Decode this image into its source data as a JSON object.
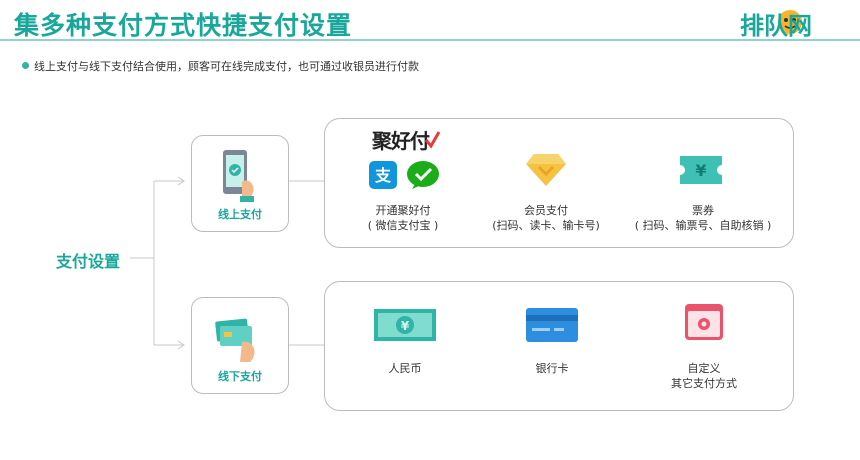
{
  "header": {
    "title": "集多种支付方式快捷支付设置",
    "brand": "排队网"
  },
  "bullet": "线上支付与线下支付结合使用，顾客可在线完成支付，也可通过收银员进行付款",
  "center_label": "支付设置",
  "online": {
    "label": "线上支付",
    "brand_text": "聚好付",
    "options": [
      {
        "line1": "开通聚好付",
        "line2": "( 微信支付宝 )"
      },
      {
        "line1": "会员支付",
        "line2": "(扫码、读卡、输卡号)"
      },
      {
        "line1": "票券",
        "line2": "( 扫码、输票号、自助核销 )"
      }
    ]
  },
  "offline": {
    "label": "线下支付",
    "options": [
      {
        "line1": "人民币",
        "line2": ""
      },
      {
        "line1": "银行卡",
        "line2": ""
      },
      {
        "line1": "自定义",
        "line2": "其它支付方式"
      }
    ]
  },
  "colors": {
    "accent": "#1aa79b",
    "card_blue": "#2d8ee0",
    "alipay": "#1296db",
    "wechat": "#1aad19",
    "gold": "#f5c242",
    "ticket": "#3ec1b4",
    "custom_pink": "#e9546b"
  }
}
